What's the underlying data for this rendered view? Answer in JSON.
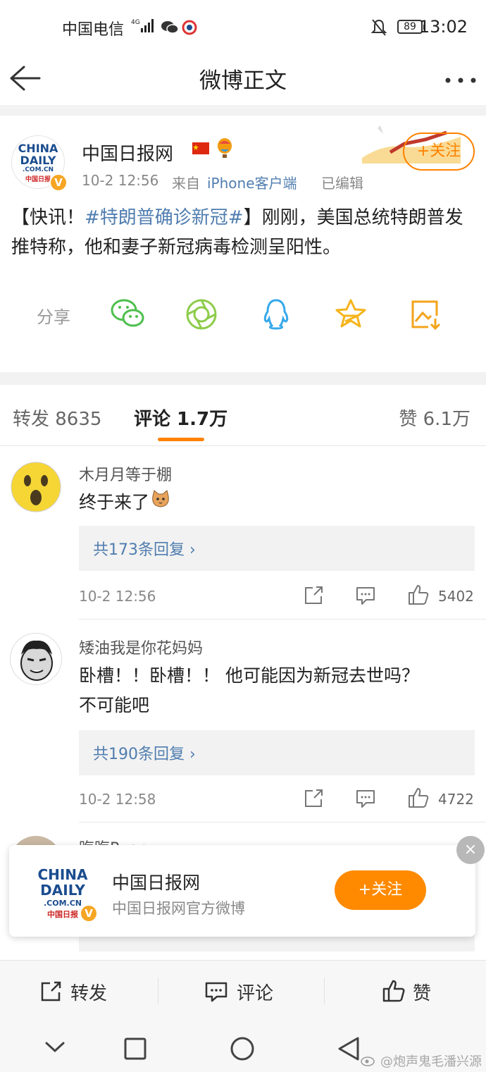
{
  "status_bar": {
    "carrier": "中国电信",
    "network": "4G",
    "battery": "89",
    "time": "13:02"
  },
  "header": {
    "title": "微博正文",
    "back_icon": "back-arrow-icon",
    "more_icon": "more-dots-icon"
  },
  "post": {
    "author": "中国日报网",
    "avatar_line1": "CHINA",
    "avatar_line2": "DAILY",
    "avatar_line3": ".COM.CN",
    "avatar_line4": "中国日报",
    "date": "10-2 12:56",
    "source_prefix": "来自",
    "source": "iPhone客户端",
    "edited": "已编辑",
    "follow_label": "+关注",
    "text_before": "【快讯！",
    "hashtag": "#特朗普确诊新冠#",
    "text_after": "】刚刚，美国总统特朗普发推特称，他和妻子新冠病毒检测呈阳性。"
  },
  "share": {
    "label": "分享",
    "icons": [
      "wechat-icon",
      "moments-icon",
      "qq-icon",
      "qzone-icon",
      "save-image-icon"
    ]
  },
  "tabs": {
    "repost": "转发 8635",
    "comment": "评论 1.7万",
    "like": "赞 6.1万"
  },
  "comments": [
    {
      "name": "木月月等于棚",
      "text": "终于来了",
      "replies": "共173条回复 ›",
      "time": "10-2 12:56",
      "likes": "5402"
    },
    {
      "name": "矮油我是你花妈妈",
      "text_line1": "卧槽！！卧槽！！ 他可能因为新冠去世吗？",
      "text_line2": "不可能吧",
      "replies": "共190条回复 ›",
      "time": "10-2 12:58",
      "likes": "4722"
    }
  ],
  "partial_comment_name": "晦晦Ryan",
  "popup": {
    "name": "中国日报网",
    "desc": "中国日报网官方微博",
    "follow_label": "+关注",
    "close": "×"
  },
  "action_bar": {
    "repost": "转发",
    "comment": "评论",
    "like": "赞"
  },
  "watermark": "@炮声鬼毛潘兴源",
  "colors": {
    "accent": "#ff8200",
    "link": "#507daf",
    "verified": "#f6a623"
  }
}
